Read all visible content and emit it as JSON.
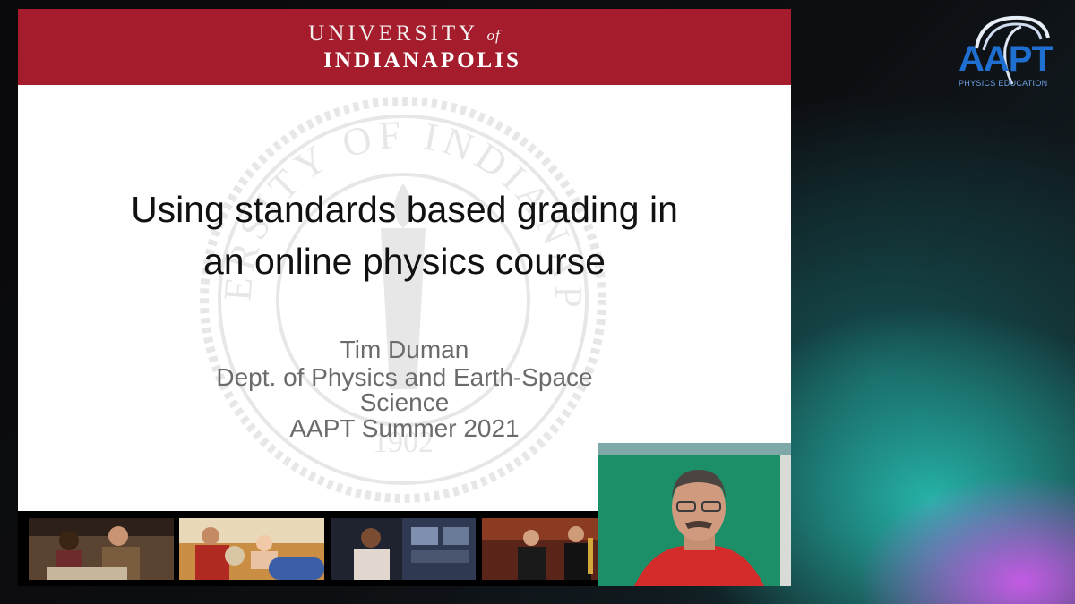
{
  "slide": {
    "university_line1_pre": "UNIVERSITY",
    "university_line1_of": "of",
    "university_line2": "INDIANAPOLIS",
    "title_line1": "Using standards based grading in",
    "title_line2": "an online physics course",
    "author": "Tim Duman",
    "department_line1": "Dept. of Physics and Earth-Space",
    "department_line2": "Science",
    "event": "AAPT Summer 2021",
    "seal_text_top": "UNIVERSITY OF INDIANAPOLIS",
    "seal_text_year": "1902"
  },
  "logo": {
    "name": "AAPT",
    "tagline": "PHYSICS EDUCATION"
  },
  "colors": {
    "header_red": "#a51d2d",
    "logo_blue": "#1f6fd1"
  }
}
